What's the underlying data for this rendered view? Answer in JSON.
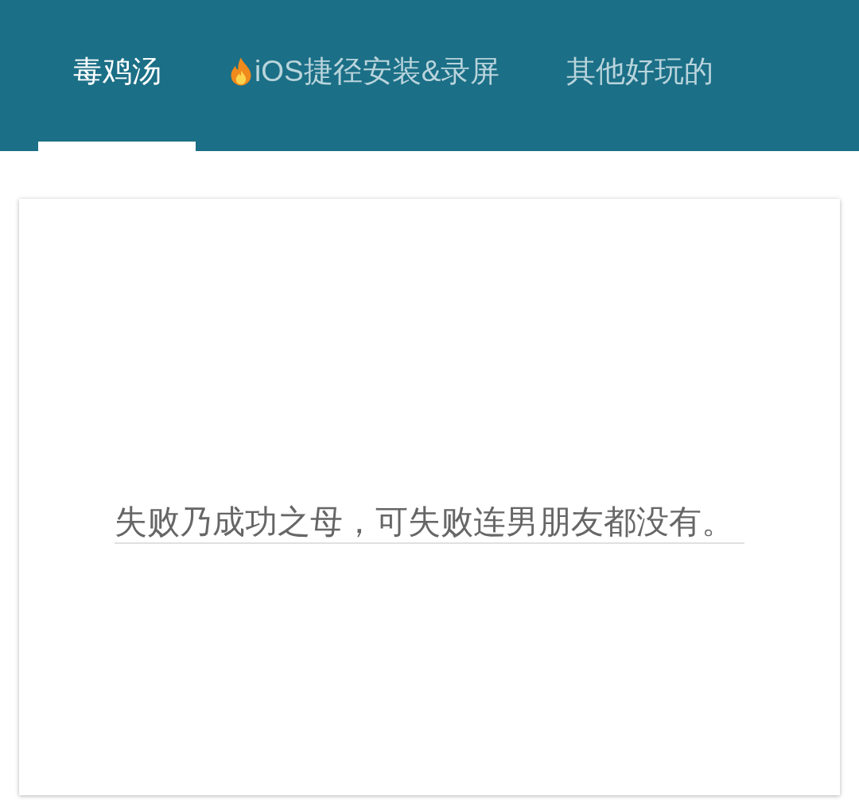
{
  "tabs": [
    {
      "label": "毒鸡汤",
      "selected": true,
      "kind": "text"
    },
    {
      "label": "iOS捷径安装&录屏",
      "selected": false,
      "kind": "fire"
    },
    {
      "label": "其他好玩的",
      "selected": false,
      "kind": "text"
    }
  ],
  "card": {
    "quote": "失败乃成功之母，可失败连男朋友都没有。"
  }
}
